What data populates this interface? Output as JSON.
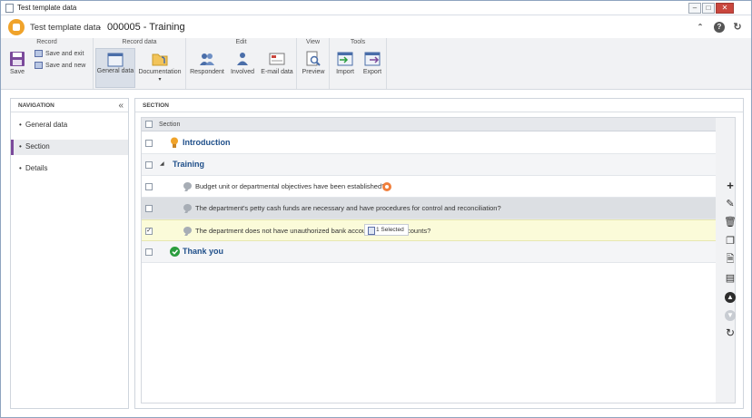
{
  "window": {
    "title": "Test template data",
    "minimize": "–",
    "maximize": "□",
    "close": "✕"
  },
  "header": {
    "app_title": "Test template data",
    "separator": "›",
    "record_title": "000005 - Training"
  },
  "ribbon": {
    "groups": {
      "record": "Record",
      "record_data": "Record data",
      "edit": "Edit",
      "view": "View",
      "tools": "Tools"
    },
    "save": "Save",
    "save_and_exit": "Save and exit",
    "save_and_new": "Save and new",
    "general_data": "General data",
    "documentation": "Documentation",
    "respondent": "Respondent",
    "involved": "Involved",
    "email_data": "E-mail data",
    "preview": "Preview",
    "import": "Import",
    "export": "Export"
  },
  "navigation": {
    "title": "NAVIGATION",
    "collapse": "«",
    "items": [
      {
        "label": "General data",
        "selected": false
      },
      {
        "label": "Section",
        "selected": true
      },
      {
        "label": "Details",
        "selected": false
      }
    ]
  },
  "section": {
    "title": "SECTION",
    "column_header": "Section",
    "rows": [
      {
        "type": "section",
        "label": "Introduction",
        "icon": "lightbulb-icon",
        "checked": false
      },
      {
        "type": "section",
        "label": "Training",
        "icon": "expand-triangle-icon",
        "checked": false
      },
      {
        "type": "question",
        "label": "Budget unit or departmental objectives have been established?",
        "checked": false,
        "badge": "orange-badge-icon"
      },
      {
        "type": "question",
        "label": "The department's petty cash funds are necessary and have procedures for control and reconciliation?",
        "checked": false
      },
      {
        "type": "question",
        "label": "The department does not have unauthorized bank account",
        "label_tail": "counts?",
        "checked": true
      },
      {
        "type": "section",
        "label": "Thank you",
        "icon": "check-circle-icon",
        "checked": false
      }
    ],
    "tooltip": "1 Selected"
  },
  "colors": {
    "accent": "#7b4a9b",
    "section_text": "#1f4f8a",
    "selected_row": "#fbfbd9",
    "check_green": "#2a9d3e",
    "bulb_orange": "#f0a32a"
  }
}
